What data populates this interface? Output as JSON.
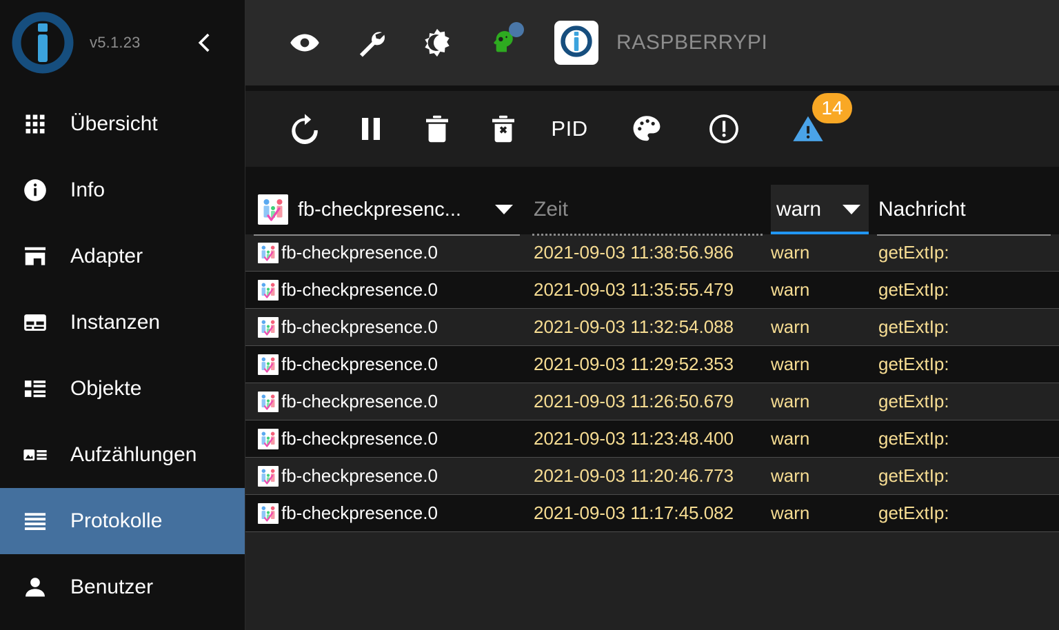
{
  "sidebar": {
    "version": "v5.1.23",
    "logo_icon": "iobroker-logo-icon",
    "collapse_icon": "chevron-left-icon",
    "items": [
      {
        "label": "Übersicht",
        "icon": "apps-grid-icon",
        "selected": false
      },
      {
        "label": "Info",
        "icon": "info-circle-icon",
        "selected": false
      },
      {
        "label": "Adapter",
        "icon": "store-icon",
        "selected": false
      },
      {
        "label": "Instanzen",
        "icon": "card-icon",
        "selected": false
      },
      {
        "label": "Objekte",
        "icon": "list-icon",
        "selected": false
      },
      {
        "label": "Aufzählungen",
        "icon": "enums-icon",
        "selected": false
      },
      {
        "label": "Protokolle",
        "icon": "log-lines-icon",
        "selected": true
      },
      {
        "label": "Benutzer",
        "icon": "user-icon",
        "selected": false
      }
    ]
  },
  "topbar": {
    "host_name": "RASPBERRYPI",
    "icons": [
      {
        "name": "eye-icon"
      },
      {
        "name": "wrench-icon"
      },
      {
        "name": "brightness-moon-icon"
      },
      {
        "name": "expert-mode-head-icon",
        "badge": "blue-dot"
      }
    ],
    "host_logo_icon": "iobroker-logo-icon"
  },
  "logbar": {
    "buttons": [
      {
        "name": "refresh-icon",
        "label": ""
      },
      {
        "name": "pause-icon",
        "label": ""
      },
      {
        "name": "delete-icon",
        "label": ""
      },
      {
        "name": "delete-all-icon",
        "label": ""
      },
      {
        "name": "pid-toggle",
        "label": "PID"
      },
      {
        "name": "palette-icon",
        "label": ""
      },
      {
        "name": "error-circle-icon",
        "label": ""
      }
    ],
    "warning_button": {
      "name": "warning-triangle-icon",
      "count": "14",
      "badge_color": "#f9a825",
      "triangle_color": "#4aa3e8"
    }
  },
  "table": {
    "headers": {
      "source": "fb-checkpresenc...",
      "source_icon": "fb-checkpresence-adapter-icon",
      "time_placeholder": "Zeit",
      "severity": "warn",
      "message": "Nachricht"
    },
    "rows": [
      {
        "source": "fb-checkpresence.0",
        "time": "2021-09-03 11:38:56.986",
        "severity": "warn",
        "message": "getExtIp:"
      },
      {
        "source": "fb-checkpresence.0",
        "time": "2021-09-03 11:35:55.479",
        "severity": "warn",
        "message": "getExtIp:"
      },
      {
        "source": "fb-checkpresence.0",
        "time": "2021-09-03 11:32:54.088",
        "severity": "warn",
        "message": "getExtIp:"
      },
      {
        "source": "fb-checkpresence.0",
        "time": "2021-09-03 11:29:52.353",
        "severity": "warn",
        "message": "getExtIp:"
      },
      {
        "source": "fb-checkpresence.0",
        "time": "2021-09-03 11:26:50.679",
        "severity": "warn",
        "message": "getExtIp:"
      },
      {
        "source": "fb-checkpresence.0",
        "time": "2021-09-03 11:23:48.400",
        "severity": "warn",
        "message": "getExtIp:"
      },
      {
        "source": "fb-checkpresence.0",
        "time": "2021-09-03 11:20:46.773",
        "severity": "warn",
        "message": "getExtIp:"
      },
      {
        "source": "fb-checkpresence.0",
        "time": "2021-09-03 11:17:45.082",
        "severity": "warn",
        "message": "getExtIp:"
      }
    ]
  },
  "colors": {
    "accent_selected": "#44709e",
    "log_text": "#f7dd93",
    "select_underline": "#2196f3",
    "badge": "#f9a825"
  }
}
